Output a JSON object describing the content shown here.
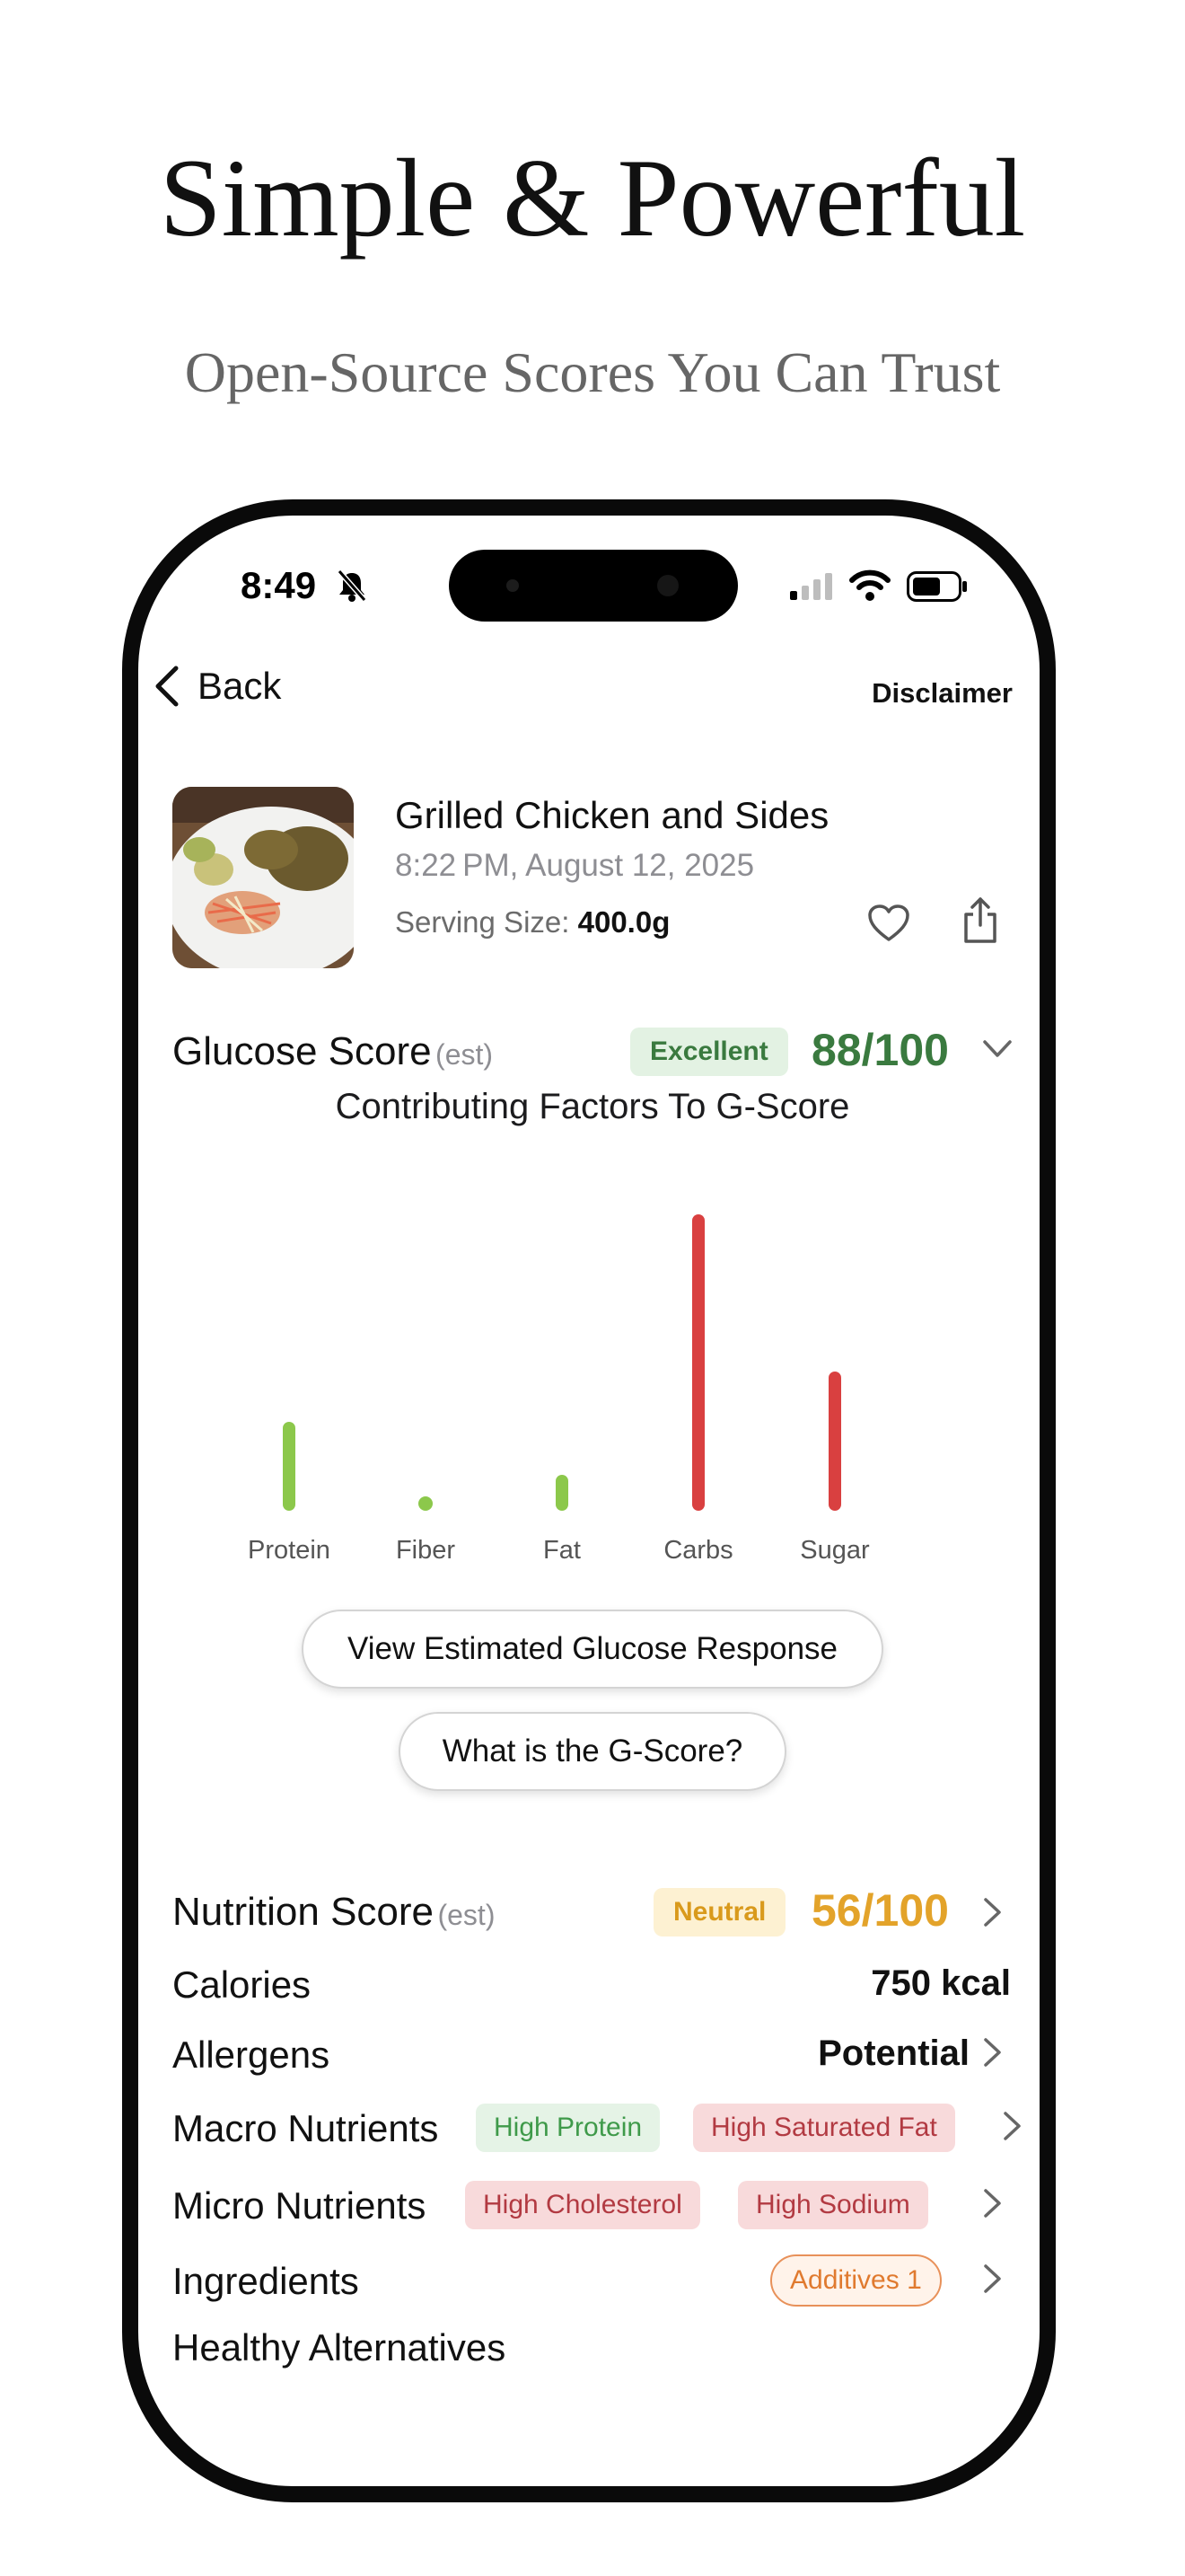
{
  "headline": "Simple & Powerful",
  "subheadline": "Open-Source Scores You Can Trust",
  "status_bar": {
    "time": "8:49"
  },
  "nav": {
    "back_label": "Back",
    "disclaimer_label": "Disclaimer"
  },
  "meal": {
    "title": "Grilled Chicken and Sides",
    "datetime": "8:22 PM, August 12, 2025",
    "serving_label": "Serving Size:",
    "serving_value": "400.0g"
  },
  "glucose": {
    "title": "Glucose Score",
    "est": "(est)",
    "rating": "Excellent",
    "score": "88/100",
    "colors": {
      "rating_bg": "#e3f2e3",
      "rating_text": "#3a7a3f",
      "score": "#3a7a3f"
    }
  },
  "chart_data": {
    "type": "bar",
    "title": "Contributing Factors To G-Score",
    "categories": [
      "Protein",
      "Fiber",
      "Fat",
      "Carbs",
      "Sugar"
    ],
    "values": [
      30,
      2,
      12,
      100,
      47
    ],
    "colors": [
      "#8cc84b",
      "#8cc84b",
      "#8cc84b",
      "#d94040",
      "#d94040"
    ]
  },
  "buttons": {
    "glucose_response": "View Estimated Glucose Response",
    "what_is_gscore": "What is the G-Score?"
  },
  "nutrition": {
    "title": "Nutrition Score",
    "est": "(est)",
    "rating": "Neutral",
    "score": "56/100",
    "colors": {
      "rating_bg": "#fdf1d2",
      "rating_text": "#d99a1c",
      "score": "#e3a32a"
    }
  },
  "rows": {
    "calories_label": "Calories",
    "calories_value": "750 kcal",
    "allergens_label": "Allergens",
    "allergens_value": "Potential",
    "macro_label": "Macro Nutrients",
    "macro_tags": [
      "High Protein",
      "High Saturated Fat"
    ],
    "micro_label": "Micro Nutrients",
    "micro_tags": [
      "High Cholesterol",
      "High Sodium"
    ],
    "ingredients_label": "Ingredients",
    "ingredients_tag": "Additives 1",
    "alternatives_label": "Healthy Alternatives"
  }
}
